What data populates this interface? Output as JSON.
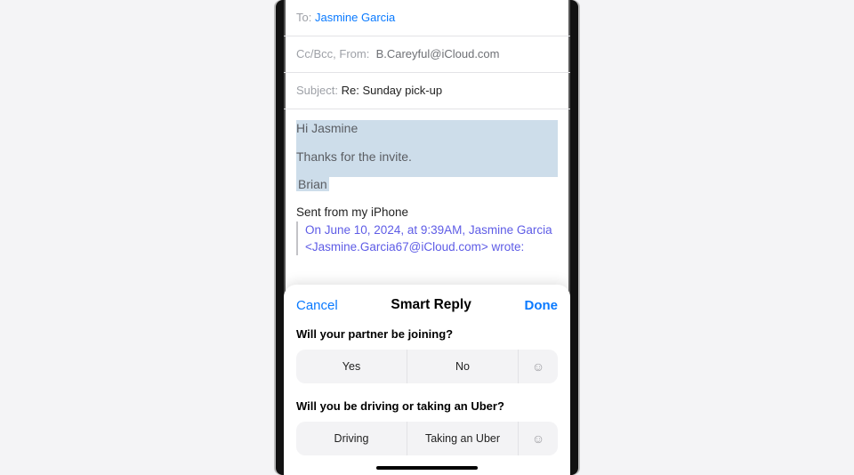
{
  "compose": {
    "to_label": "To:",
    "to_recipient": "Jasmine Garcia",
    "ccbcc_label": "Cc/Bcc, From:",
    "ccbcc_value": "B.Careyful@iCloud.com",
    "subject_label": "Subject:",
    "subject_value": "Re: Sunday pick-up"
  },
  "body": {
    "greeting": "Hi Jasmine",
    "line2": "Thanks for the invite.",
    "signature": "Brian",
    "sent_from": "Sent from my iPhone",
    "quote_line1": "On June 10, 2024, at 9:39AM, Jasmine Garcia",
    "quote_line2": "<Jasmine.Garcia67@iCloud.com> wrote:"
  },
  "sheet": {
    "cancel": "Cancel",
    "title": "Smart Reply",
    "done": "Done",
    "q1": "Will your partner be joining?",
    "q1_opt1": "Yes",
    "q1_opt2": "No",
    "emoji": "☺",
    "q2": "Will you be driving or taking an Uber?",
    "q2_opt1": "Driving",
    "q2_opt2": "Taking an Uber"
  }
}
